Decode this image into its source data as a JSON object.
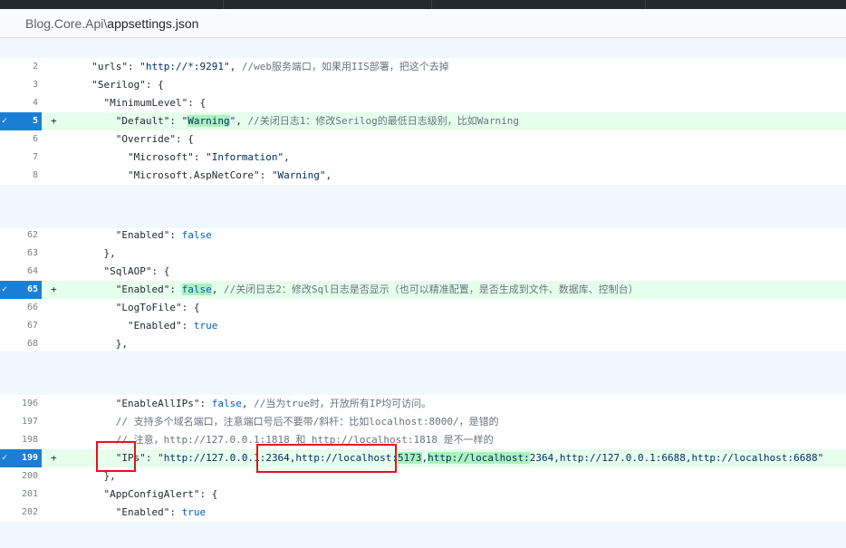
{
  "file": {
    "dir": "Blog.Core.Api\\",
    "name": "appsettings.json"
  },
  "lines": [
    {
      "num": "2",
      "added": false,
      "marker": "",
      "indent": "  ",
      "parts": [
        [
          "k",
          "\"urls\": "
        ],
        [
          "s",
          "\"http://*:9291\""
        ],
        [
          "k",
          ", "
        ],
        [
          "c",
          "//web服务端口，如果用IIS部署，把这个去掉"
        ]
      ]
    },
    {
      "num": "3",
      "added": false,
      "marker": "",
      "indent": "  ",
      "parts": [
        [
          "k",
          "\"Serilog\": {"
        ]
      ]
    },
    {
      "num": "4",
      "added": false,
      "marker": "",
      "indent": "    ",
      "parts": [
        [
          "k",
          "\"MinimumLevel\": {"
        ]
      ]
    },
    {
      "num": "5",
      "added": true,
      "marker": "+",
      "indent": "      ",
      "parts": [
        [
          "k",
          "\"Default\": "
        ],
        [
          "s",
          "\""
        ],
        [
          "shl",
          "Warning"
        ],
        [
          "s",
          "\""
        ],
        [
          "k",
          ", "
        ],
        [
          "c",
          "//关闭日志1：修改Serilog的最低日志级别，比如Warning"
        ]
      ]
    },
    {
      "num": "6",
      "added": false,
      "marker": "",
      "indent": "      ",
      "parts": [
        [
          "k",
          "\"Override\": {"
        ]
      ]
    },
    {
      "num": "7",
      "added": false,
      "marker": "",
      "indent": "        ",
      "parts": [
        [
          "k",
          "\"Microsoft\": "
        ],
        [
          "s",
          "\"Information\""
        ],
        [
          "k",
          ","
        ]
      ]
    },
    {
      "num": "8",
      "added": false,
      "marker": "",
      "indent": "        ",
      "parts": [
        [
          "k",
          "\"Microsoft.AspNetCore\": "
        ],
        [
          "s",
          "\"Warning\""
        ],
        [
          "k",
          ","
        ]
      ]
    },
    {
      "num": "62",
      "added": false,
      "marker": "",
      "indent": "      ",
      "parts": [
        [
          "k",
          "\"Enabled\": "
        ],
        [
          "b",
          "false"
        ]
      ]
    },
    {
      "num": "63",
      "added": false,
      "marker": "",
      "indent": "    ",
      "parts": [
        [
          "k",
          "},"
        ]
      ]
    },
    {
      "num": "64",
      "added": false,
      "marker": "",
      "indent": "    ",
      "parts": [
        [
          "k",
          "\"SqlAOP\": {"
        ]
      ]
    },
    {
      "num": "65",
      "added": true,
      "marker": "+",
      "indent": "      ",
      "parts": [
        [
          "k",
          "\"Enabled\": "
        ],
        [
          "bhl",
          "false"
        ],
        [
          "k",
          ", "
        ],
        [
          "c",
          "//关闭日志2：修改Sql日志是否显示（也可以精准配置，是否生成到文件、数据库、控制台）"
        ]
      ]
    },
    {
      "num": "66",
      "added": false,
      "marker": "",
      "indent": "      ",
      "parts": [
        [
          "k",
          "\"LogToFile\": {"
        ]
      ]
    },
    {
      "num": "67",
      "added": false,
      "marker": "",
      "indent": "        ",
      "parts": [
        [
          "k",
          "\"Enabled\": "
        ],
        [
          "b",
          "true"
        ]
      ]
    },
    {
      "num": "68",
      "added": false,
      "marker": "",
      "indent": "      ",
      "parts": [
        [
          "k",
          "},"
        ]
      ]
    },
    {
      "num": "196",
      "added": false,
      "marker": "",
      "indent": "      ",
      "parts": [
        [
          "k",
          "\"EnableAllIPs\": "
        ],
        [
          "b",
          "false"
        ],
        [
          "k",
          ", "
        ],
        [
          "c",
          "//当为true时，开放所有IP均可访问。"
        ]
      ]
    },
    {
      "num": "197",
      "added": false,
      "marker": "",
      "indent": "      ",
      "parts": [
        [
          "c",
          "// 支持多个域名端口，注意端口号后不要带/斜杆：比如localhost:8000/，是错的"
        ]
      ]
    },
    {
      "num": "198",
      "added": false,
      "marker": "",
      "indent": "      ",
      "parts": [
        [
          "c",
          "// 注意，http://127.0.0.1:1818 和 http://localhost:1818 是不一样的"
        ]
      ]
    },
    {
      "num": "199",
      "added": true,
      "marker": "+",
      "indent": "      ",
      "parts": [
        [
          "k",
          "\"IPs\": "
        ],
        [
          "s",
          "\"http://127.0.0.1:2364,http://localhost:"
        ],
        [
          "shl",
          "5173"
        ],
        [
          "s",
          ","
        ],
        [
          "shl",
          "http://localhost:"
        ],
        [
          "s",
          "2364,http://127.0.0.1:6688,http://localhost:6688\""
        ]
      ]
    },
    {
      "num": "200",
      "added": false,
      "marker": "",
      "indent": "    ",
      "parts": [
        [
          "k",
          "},"
        ]
      ]
    },
    {
      "num": "201",
      "added": false,
      "marker": "",
      "indent": "    ",
      "parts": [
        [
          "k",
          "\"AppConfigAlert\": {"
        ]
      ]
    },
    {
      "num": "202",
      "added": false,
      "marker": "",
      "indent": "      ",
      "parts": [
        [
          "k",
          "\"Enabled\": "
        ],
        [
          "b",
          "true"
        ]
      ]
    }
  ],
  "colors": {
    "added_bg": "#e6ffed",
    "highlight": "#acf2bd",
    "hunk_bg": "#f1f8ff",
    "selected_gutter": "#1a7fd4",
    "annotation": "#e0141a"
  }
}
